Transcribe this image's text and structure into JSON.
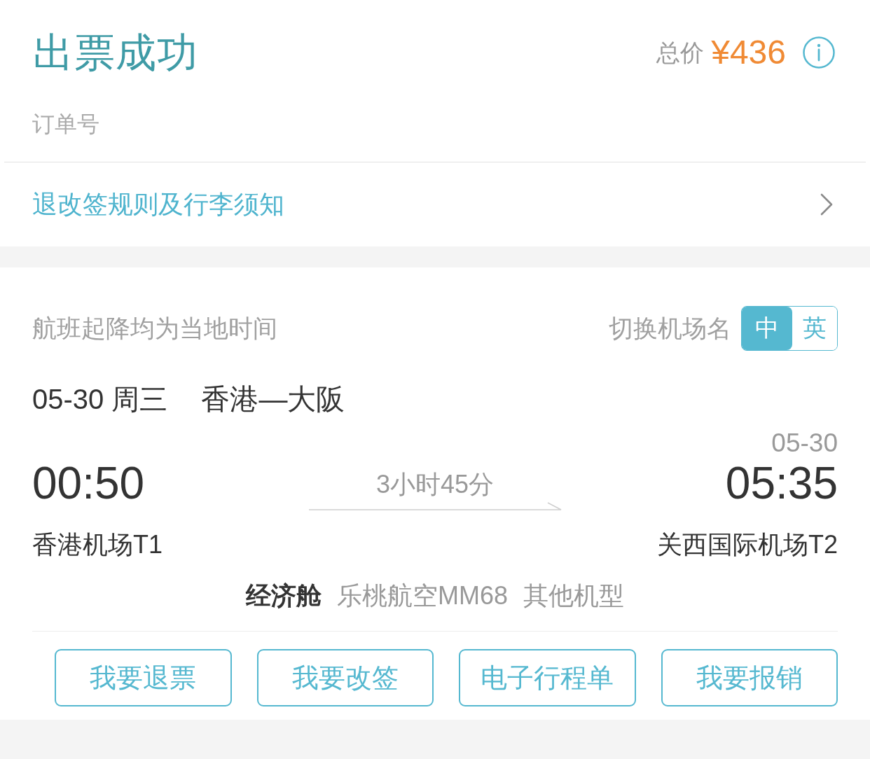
{
  "header": {
    "title": "出票成功",
    "price_label": "总价",
    "price": "¥436"
  },
  "order": {
    "label": "订单号"
  },
  "rules_link": {
    "label": "退改签规则及行李须知"
  },
  "flight": {
    "timezone_note": "航班起降均为当地时间",
    "airport_name_switch": {
      "label": "切换机场名",
      "options": [
        {
          "label": "中",
          "selected": true
        },
        {
          "label": "英",
          "selected": false
        }
      ]
    },
    "date": "05-30 周三",
    "route": "香港—大阪",
    "arrival_date": "05-30",
    "departure_time": "00:50",
    "duration": "3小时45分",
    "arrival_time": "05:35",
    "departure_airport": "香港机场T1",
    "arrival_airport": "关西国际机场T2",
    "cabin": "经济舱",
    "airline_flight": "乐桃航空MM68",
    "aircraft": "其他机型"
  },
  "actions": [
    "我要退票",
    "我要改签",
    "电子行程单",
    "我要报销"
  ]
}
